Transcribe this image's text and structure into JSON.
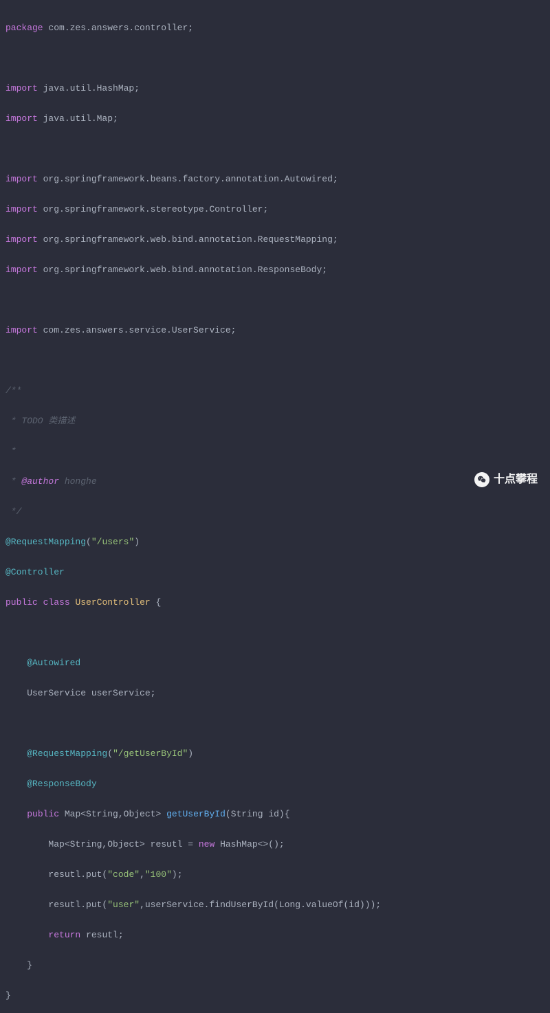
{
  "lines": {
    "l1": {
      "kw": "package",
      "rest": " com.zes.answers.controller;"
    },
    "l3": {
      "kw": "import",
      "rest": " java.util.HashMap;"
    },
    "l4": {
      "kw": "import",
      "rest": " java.util.Map;"
    },
    "l6": {
      "kw": "import",
      "rest": " org.springframework.beans.factory.annotation.Autowired;"
    },
    "l7": {
      "kw": "import",
      "rest": " org.springframework.stereotype.Controller;"
    },
    "l8": {
      "kw": "import",
      "rest": " org.springframework.web.bind.annotation.RequestMapping;"
    },
    "l9": {
      "kw": "import",
      "rest": " org.springframework.web.bind.annotation.ResponseBody;"
    },
    "l11": {
      "kw": "import",
      "rest": " com.zes.answers.service.UserService;"
    },
    "c1": "/**",
    "c2": " * TODO 类描述",
    "c3": " *",
    "c4a": " * ",
    "c4tag": "@author",
    "c4b": " honghe",
    "c5": " */",
    "anno1": {
      "name": "@RequestMapping",
      "paren1": "(",
      "str": "\"/users\"",
      "paren2": ")"
    },
    "anno2": "@Controller",
    "classDecl": {
      "pub": "public",
      "sp1": " ",
      "cls": "class",
      "sp2": " ",
      "name": "UserController",
      "brace": " {"
    },
    "anno3": "    @Autowired",
    "field": "    UserService userService;",
    "anno4": {
      "indent": "    ",
      "name": "@RequestMapping",
      "paren1": "(",
      "str": "\"/getUserById\"",
      "paren2": ")"
    },
    "anno5": "    @ResponseBody",
    "method": {
      "indent": "    ",
      "pub": "public",
      "sp1": " ",
      "type": "Map<String,Object> ",
      "fn": "getUserById",
      "params": "(String id){"
    },
    "body1": {
      "indent": "        ",
      "pre": "Map<String,Object> resutl = ",
      "nw": "new",
      "post": " HashMap<>();"
    },
    "body2": {
      "indent": "        ",
      "pre": "resutl.put(",
      "s1": "\"code\"",
      "mid": ",",
      "s2": "\"100\"",
      "end": ");"
    },
    "body3": {
      "indent": "        ",
      "pre": "resutl.put(",
      "s1": "\"user\"",
      "end": ",userService.findUserById(Long.valueOf(id)));"
    },
    "body4": {
      "indent": "        ",
      "ret": "return",
      "rest": " resutl;"
    },
    "close1": "    }",
    "close2": "}"
  },
  "watermark": {
    "text": "十点攀程"
  }
}
